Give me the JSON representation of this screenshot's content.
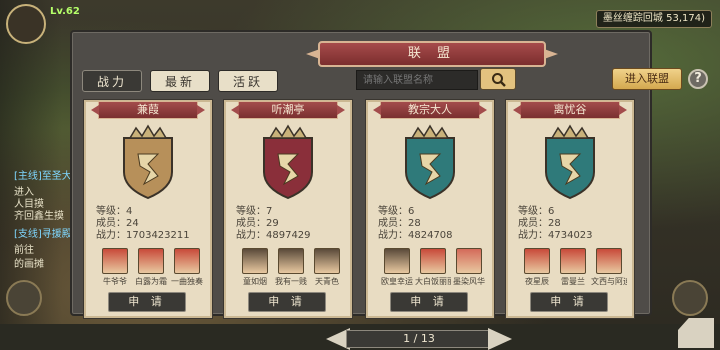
{
  "hud": {
    "level": "Lv.62",
    "coordinates": "墨丝缠踪回城 53,174)",
    "quests": [
      {
        "text": "[主线]至圣大",
        "tag": true
      },
      {
        "text": "进入",
        "tag": false
      },
      {
        "text": "人目摸",
        "tag": false
      },
      {
        "text": "齐回鑫生摸",
        "tag": false
      },
      {
        "text": "[支线]寻援殿",
        "tag": true
      },
      {
        "text": "前往",
        "tag": false
      },
      {
        "text": "的画摊",
        "tag": false
      }
    ]
  },
  "panel": {
    "title": "联 盟",
    "tabs": [
      {
        "label": "战力",
        "active": true
      },
      {
        "label": "最新",
        "active": false
      },
      {
        "label": "活跃",
        "active": false
      }
    ],
    "search_placeholder": "请输入联盟名称",
    "join_label": "进入联盟",
    "help_label": "?"
  },
  "alliances": [
    {
      "name": "兼葭",
      "level": "等级：4",
      "members": "成员：24",
      "power": "战力：1703423211",
      "emblem_color": "#b7905a",
      "member_names": [
        "牛爷爷",
        "白露为霜",
        "一曲独奏"
      ],
      "avatar_colors": [
        "#c84a3a",
        "#c84a3a",
        "#c84a3a"
      ],
      "apply_label": "申 请"
    },
    {
      "name": "听潮亭",
      "level": "等级：7",
      "members": "成员：29",
      "power": "战力：4897429",
      "emblem_color": "#8a2f3a",
      "member_names": [
        "童如烟",
        "我有一贱",
        "天青色"
      ],
      "avatar_colors": [
        "#5a4a3a",
        "#5a4a3a",
        "#5a4a3a"
      ],
      "apply_label": "申 请"
    },
    {
      "name": "教宗大人",
      "level": "等级：6",
      "members": "成员：28",
      "power": "战力：4824708",
      "emblem_color": "#2f7a7a",
      "member_names": [
        "欧皇幸运",
        "大白饭丽丽",
        "墨染风华"
      ],
      "avatar_colors": [
        "#5a4a3a",
        "#c84a3a",
        "#d46a5a"
      ],
      "apply_label": "申 请"
    },
    {
      "name": "离忧谷",
      "level": "等级：6",
      "members": "成员：28",
      "power": "战力：4734023",
      "emblem_color": "#2f7a7a",
      "member_names": [
        "夜星辰",
        "雷曼兰",
        "文西与阿迪"
      ],
      "avatar_colors": [
        "#c84a3a",
        "#c84a3a",
        "#c84a3a"
      ],
      "apply_label": "申 请"
    }
  ],
  "pager": {
    "text": "1 / 13"
  }
}
